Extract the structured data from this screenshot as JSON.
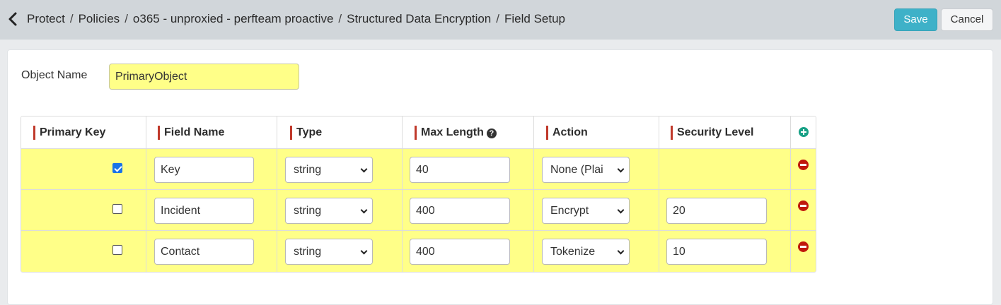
{
  "breadcrumb": [
    "Protect",
    "Policies",
    "o365 - unproxied - perfteam proactive",
    "Structured Data Encryption",
    "Field Setup"
  ],
  "breadcrumb_separator": "/",
  "toolbar": {
    "save_label": "Save",
    "cancel_label": "Cancel"
  },
  "colors": {
    "save": "#3eb1c8",
    "row_highlight": "#ffff88",
    "required_marker": "#c0392b",
    "add": "#16a085",
    "remove": "#c0180c"
  },
  "object": {
    "label": "Object Name",
    "value": "PrimaryObject"
  },
  "columns": [
    "Primary Key",
    "Field Name",
    "Type",
    "Max Length",
    "Action",
    "Security Level"
  ],
  "icons": {
    "back": "chevron-left-icon",
    "help": "question-circle-icon",
    "add": "plus-circle-icon",
    "remove": "minus-circle-icon"
  },
  "rows": [
    {
      "primary_key": true,
      "field_name": "Key",
      "type": "string",
      "max_length": "40",
      "action": "None (Plai",
      "security_level": null
    },
    {
      "primary_key": false,
      "field_name": "Incident",
      "type": "string",
      "max_length": "400",
      "action": "Encrypt",
      "security_level": "20"
    },
    {
      "primary_key": false,
      "field_name": "Contact",
      "type": "string",
      "max_length": "400",
      "action": "Tokenize",
      "security_level": "10"
    }
  ]
}
